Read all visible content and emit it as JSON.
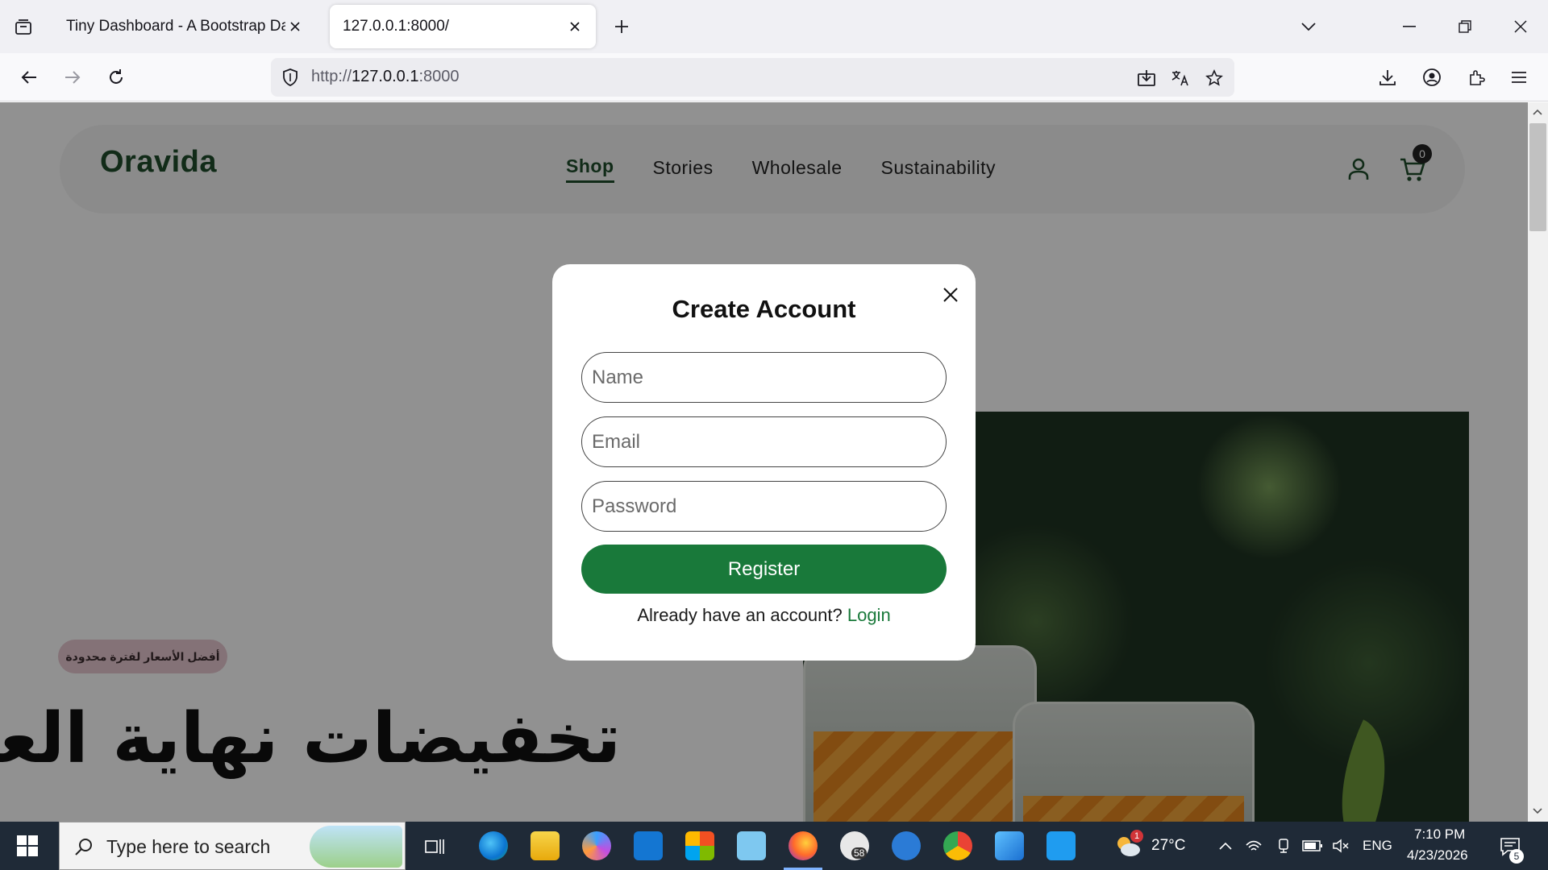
{
  "browser": {
    "tabs": [
      {
        "title": "Tiny Dashboard - A Bootstrap Dashl",
        "active": false
      },
      {
        "title": "127.0.0.1:8000/",
        "active": true
      }
    ],
    "url": {
      "scheme": "http://",
      "host": "127.0.0.1",
      "port": ":8000"
    }
  },
  "site": {
    "brand": "Oravida",
    "nav": [
      {
        "label": "Shop",
        "active": true
      },
      {
        "label": "Stories"
      },
      {
        "label": "Wholesale"
      },
      {
        "label": "Sustainability"
      }
    ],
    "cart_count": "0",
    "hero": {
      "badge": "أفضل الأسعار لفترة محدودة",
      "title": "تخفيضات نهاية العام"
    }
  },
  "modal": {
    "title": "Create Account",
    "name_placeholder": "Name",
    "email_placeholder": "Email",
    "password_placeholder": "Password",
    "register_label": "Register",
    "login_prompt": "Already have an account?",
    "login_link": "Login"
  },
  "taskbar": {
    "search_placeholder": "Type here to search",
    "weather_temp": "27°C",
    "weather_alert": "1",
    "language": "ENG",
    "time": "7:10 PM",
    "date": "4/23/2026",
    "notifications": "5",
    "badge_58": "58"
  },
  "colors": {
    "brand_green": "#1e4d2b",
    "button_green": "#19793a",
    "badge_pink": "#e9c9d1"
  }
}
